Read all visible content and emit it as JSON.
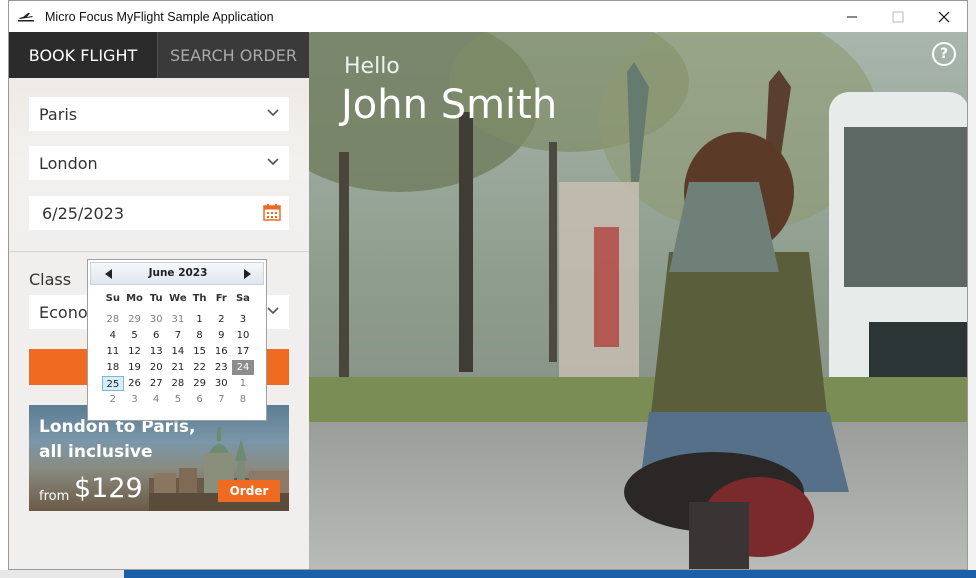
{
  "window": {
    "title": "Micro Focus MyFlight Sample Application",
    "controls": {
      "minimize": "minimize-icon",
      "maximize": "maximize-icon",
      "close": "close-icon"
    }
  },
  "tabs": [
    {
      "label": "BOOK FLIGHT",
      "active": true
    },
    {
      "label": "SEARCH ORDER",
      "active": false
    }
  ],
  "form": {
    "from": "Paris",
    "to": "London",
    "date": "6/25/2023",
    "class_label": "Class",
    "class_value": "Econor"
  },
  "calendar": {
    "month": "June 2023",
    "dows": [
      "Su",
      "Mo",
      "Tu",
      "We",
      "Th",
      "Fr",
      "Sa"
    ],
    "weeks": [
      [
        "28",
        "29",
        "30",
        "31",
        "1",
        "2",
        "3"
      ],
      [
        "4",
        "5",
        "6",
        "7",
        "8",
        "9",
        "10"
      ],
      [
        "11",
        "12",
        "13",
        "14",
        "15",
        "16",
        "17"
      ],
      [
        "18",
        "19",
        "20",
        "21",
        "22",
        "23",
        "24"
      ],
      [
        "25",
        "26",
        "27",
        "28",
        "29",
        "30",
        "1"
      ],
      [
        "2",
        "3",
        "4",
        "5",
        "6",
        "7",
        "8"
      ]
    ],
    "selected_day": "24",
    "today_day": "25"
  },
  "promo": {
    "title": "London to Paris, all inclusive",
    "from_label": "from",
    "price": "$129",
    "order_label": "Order"
  },
  "hero": {
    "greeting": "Hello",
    "user_name": "John Smith",
    "help": "?"
  },
  "colors": {
    "accent": "#f06b22",
    "tab_bg": "#2e2e2e",
    "selected_day": "#8c8c8c",
    "today_day": "#d6eefb"
  }
}
